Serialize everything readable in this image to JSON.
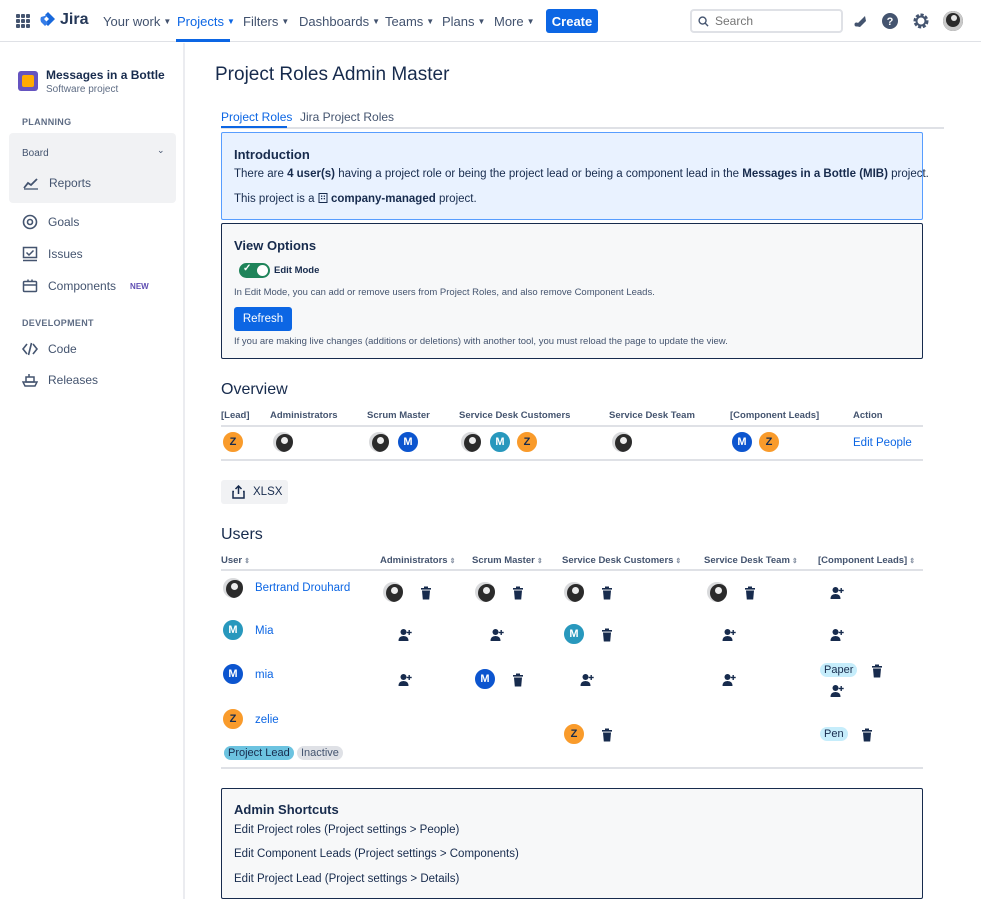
{
  "nav": {
    "app_name": "Jira",
    "items": [
      {
        "label": "Your work"
      },
      {
        "label": "Projects"
      },
      {
        "label": "Filters"
      },
      {
        "label": "Dashboards"
      },
      {
        "label": "Teams"
      },
      {
        "label": "Plans"
      },
      {
        "label": "More"
      }
    ],
    "create_label": "Create",
    "search_placeholder": "Search",
    "accent_color": "#0c66e4"
  },
  "sidebar": {
    "project_name": "Messages in a Bottle",
    "project_type": "Software project",
    "planning_heading": "PLANNING",
    "board_label": "Board",
    "reports_label": "Reports",
    "goals_label": "Goals",
    "issues_label": "Issues",
    "components_label": "Components",
    "components_badge": "NEW",
    "development_heading": "DEVELOPMENT",
    "code_label": "Code",
    "releases_label": "Releases"
  },
  "page": {
    "title": "Project Roles Admin Master",
    "tabs": [
      {
        "label": "Project Roles"
      },
      {
        "label": "Jira Project Roles"
      }
    ]
  },
  "intro": {
    "heading": "Introduction",
    "line1_a": "There are ",
    "line1_count": "4 user(s)",
    "line1_b": " having a project role or being the project lead or being a component lead in the ",
    "line1_project": "Messages in a Bottle (MIB)",
    "line1_c": " project.",
    "line2_a": "This project is a ",
    "line2_type": "company-managed",
    "line2_b": " project."
  },
  "view_options": {
    "heading": "View Options",
    "toggle_label": "Edit Mode",
    "toggle_on": true,
    "help_text": "In Edit Mode, you can add or remove users from Project Roles, and also remove Component Leads.",
    "refresh_label": "Refresh",
    "refresh_note": "If you are making live changes (additions or deletions) with another tool, you must reload the page to update the view."
  },
  "overview": {
    "title": "Overview",
    "headers": [
      "[Lead]",
      "Administrators",
      "Scrum Master",
      "Service Desk Customers",
      "Service Desk Team",
      "[Component Leads]",
      "Action"
    ],
    "action_label": "Edit People",
    "avatar_letters": {
      "z": "Z",
      "m": "M"
    }
  },
  "export": {
    "label": "XLSX"
  },
  "users": {
    "title": "Users",
    "headers": [
      "User",
      "Administrators",
      "Scrum Master",
      "Service Desk Customers",
      "Service Desk Team",
      "[Component Leads]"
    ],
    "rows": [
      {
        "name": "Bertrand Drouhard",
        "initial": ""
      },
      {
        "name": "Mia",
        "initial": "M"
      },
      {
        "name": "mia",
        "initial": "M"
      },
      {
        "name": "zelie",
        "initial": "Z"
      }
    ],
    "component_paper": "Paper",
    "component_pen": "Pen",
    "badge_lead": "Project Lead",
    "badge_inactive": "Inactive"
  },
  "shortcuts": {
    "heading": "Admin Shortcuts",
    "links": [
      {
        "label": "Edit Project roles (Project settings > People)"
      },
      {
        "label": "Edit Component Leads (Project settings > Components)"
      },
      {
        "label": "Edit Project Lead (Project settings > Details)"
      }
    ]
  }
}
